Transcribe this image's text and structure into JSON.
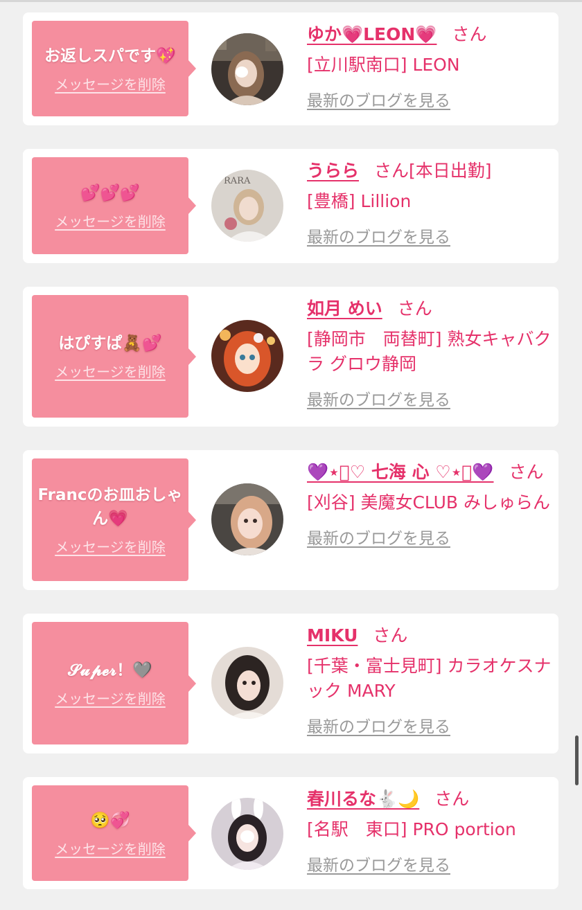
{
  "cards": [
    {
      "message": "お返しスパです💖",
      "delete_label": "メッセージを削除",
      "avatar_text": "",
      "name": "ゆか💗LEON💗",
      "san": "さん",
      "extra": "",
      "shop": "[立川駅南口] LEON",
      "blog_label": "最新のブログを見る"
    },
    {
      "message": "💕💕💕",
      "delete_label": "メッセージを削除",
      "avatar_text": "RARA",
      "name": "うらら",
      "san": "さん",
      "extra": "[本日出勤]",
      "shop": "[豊橋] Lillion",
      "blog_label": "最新のブログを見る"
    },
    {
      "message": "はぴすぱ🧸💕",
      "delete_label": "メッセージを削除",
      "avatar_text": "",
      "name": "如月 めい",
      "san": "さん",
      "extra": "",
      "shop": "[静岡市　両替町] 熟女キャバクラ グロウ静岡",
      "blog_label": "最新のブログを見る"
    },
    {
      "message": "Francのお皿おしゃん💗",
      "delete_label": "メッセージを削除",
      "avatar_text": "",
      "name": "💜⋆͛♡ 七海 心 ♡⋆͛💜",
      "san": "さん",
      "extra": "",
      "shop": "[刈谷] 美魔女CLUB みしゅらん",
      "blog_label": "最新のブログを見る"
    },
    {
      "message": "𝓢𝓾𝓹𝓮𝓻！🩶",
      "delete_label": "メッセージを削除",
      "avatar_text": "",
      "name": "MIKU",
      "san": "さん",
      "extra": "",
      "shop": "[千葉・富士見町] カラオケスナック MARY",
      "blog_label": "最新のブログを見る"
    },
    {
      "message": "🥺💞",
      "delete_label": "メッセージを削除",
      "avatar_text": "",
      "name": "春川るな🐇🌙",
      "san": "さん",
      "extra": "",
      "shop": "[名駅　東口] PRO portion",
      "blog_label": "最新のブログを見る"
    }
  ],
  "colors": {
    "accent": "#e5316a",
    "bubble": "#f58e9e",
    "link_gray": "#999999",
    "background": "#f0f0f0"
  }
}
